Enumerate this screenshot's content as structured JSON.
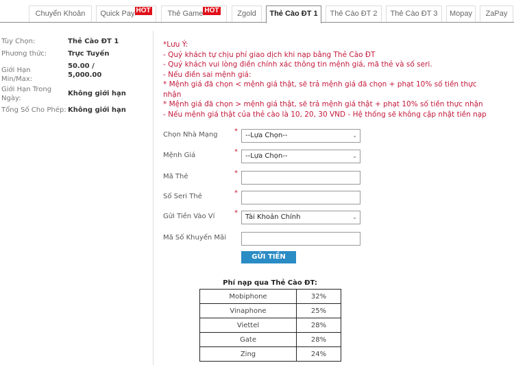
{
  "tabs": [
    {
      "label": "Chuyển Khoản",
      "hot": false
    },
    {
      "label": "Quick Pay",
      "hot": true
    },
    {
      "label": "Thẻ Game",
      "hot": true
    },
    {
      "label": "Zgold",
      "hot": false
    },
    {
      "label": "Thẻ Cào ĐT 1",
      "hot": false,
      "active": true
    },
    {
      "label": "Thẻ Cào ĐT 2",
      "hot": false
    },
    {
      "label": "Thẻ Cào ĐT 3",
      "hot": false
    },
    {
      "label": "Mopay",
      "hot": false
    },
    {
      "label": "ZaPay",
      "hot": false
    }
  ],
  "hot_label": "HOT",
  "info": [
    {
      "key": "Tùy Chọn:",
      "value": "Thẻ Cào ĐT 1"
    },
    {
      "key": "Phương thức:",
      "value": "Trực Tuyến"
    },
    {
      "key": "Giới Hạn Min/Max:",
      "value": "50.00 / 5,000.00"
    },
    {
      "key": "Giới Hạn Trong Ngày:",
      "value": "Không giới hạn"
    },
    {
      "key": "Tổng Số Cho Phép:",
      "value": "Không giới hạn"
    }
  ],
  "notes": [
    "*Lưu Ý:",
    "- Quý khách tự chịu phí giao dịch khi nạp bằng Thẻ Cào ĐT",
    "- Quý khách vui lòng điền chính xác thông tin mệnh giá, mã thẻ và số seri.",
    "- Nếu điền sai mệnh giá:",
    " * Mệnh giá đã chọn < mệnh giá thật, sẽ trả mệnh giá đã chọn + phạt 10% số tiền thực nhận",
    " * Mệnh giá đã chọn > mệnh giá thật, sẽ trả mệnh giá thật + phạt 10% số tiền thực nhận",
    "- Nếu mệnh giá thật của thẻ cào là 10, 20, 30 VND - Hệ thống sẽ không cập nhật tiền nạp"
  ],
  "form": {
    "required_mark": "*",
    "network": {
      "label": "Chọn Nhà Mạng",
      "value": "--Lựa Chọn--"
    },
    "denomination": {
      "label": "Mệnh Giá",
      "value": "--Lựa Chọn--"
    },
    "card_code": {
      "label": "Mã Thẻ",
      "value": ""
    },
    "serial": {
      "label": "Số Seri Thẻ",
      "value": ""
    },
    "wallet": {
      "label": "Gửi Tiền Vào Ví",
      "value": "Tài Khoản Chính"
    },
    "promo": {
      "label": "Mã Số Khuyến Mãi",
      "value": ""
    },
    "submit": "GỬI TIỀN"
  },
  "fees": {
    "title": "Phí nạp qua Thẻ Cào ĐT:",
    "rows": [
      {
        "name": "Mobiphone",
        "rate": "32%"
      },
      {
        "name": "Vinaphone",
        "rate": "25%"
      },
      {
        "name": "Viettel",
        "rate": "28%"
      },
      {
        "name": "Gate",
        "rate": "28%"
      },
      {
        "name": "Zing",
        "rate": "24%"
      }
    ]
  }
}
